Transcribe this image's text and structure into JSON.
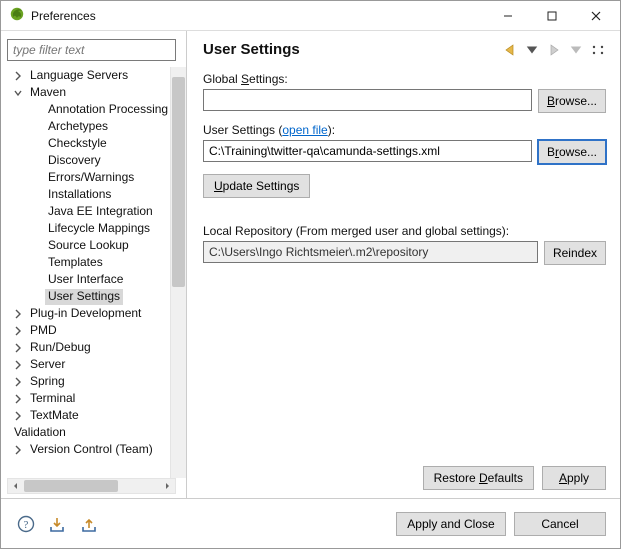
{
  "window": {
    "title": "Preferences"
  },
  "filter": {
    "placeholder": "type filter text",
    "value": ""
  },
  "tree": [
    {
      "label": "Language Servers",
      "depth": 0,
      "expand": "closed"
    },
    {
      "label": "Maven",
      "depth": 0,
      "expand": "open"
    },
    {
      "label": "Annotation Processing",
      "depth": 1,
      "expand": "none"
    },
    {
      "label": "Archetypes",
      "depth": 1,
      "expand": "none"
    },
    {
      "label": "Checkstyle",
      "depth": 1,
      "expand": "none"
    },
    {
      "label": "Discovery",
      "depth": 1,
      "expand": "none"
    },
    {
      "label": "Errors/Warnings",
      "depth": 1,
      "expand": "none"
    },
    {
      "label": "Installations",
      "depth": 1,
      "expand": "none"
    },
    {
      "label": "Java EE Integration",
      "depth": 1,
      "expand": "none"
    },
    {
      "label": "Lifecycle Mappings",
      "depth": 1,
      "expand": "none"
    },
    {
      "label": "Source Lookup",
      "depth": 1,
      "expand": "none"
    },
    {
      "label": "Templates",
      "depth": 1,
      "expand": "none"
    },
    {
      "label": "User Interface",
      "depth": 1,
      "expand": "none"
    },
    {
      "label": "User Settings",
      "depth": 1,
      "expand": "none",
      "selected": true
    },
    {
      "label": "Plug-in Development",
      "depth": 0,
      "expand": "closed"
    },
    {
      "label": "PMD",
      "depth": 0,
      "expand": "closed"
    },
    {
      "label": "Run/Debug",
      "depth": 0,
      "expand": "closed"
    },
    {
      "label": "Server",
      "depth": 0,
      "expand": "closed"
    },
    {
      "label": "Spring",
      "depth": 0,
      "expand": "closed"
    },
    {
      "label": "Terminal",
      "depth": 0,
      "expand": "closed"
    },
    {
      "label": "TextMate",
      "depth": 0,
      "expand": "closed"
    },
    {
      "label": "Validation",
      "depth": 0,
      "expand": "none"
    },
    {
      "label": "Version Control (Team)",
      "depth": 0,
      "expand": "closed"
    }
  ],
  "pane": {
    "title": "User Settings",
    "global": {
      "label_pre": "Global ",
      "label_u": "S",
      "label_post": "ettings:",
      "value": "",
      "browse_pre": "",
      "browse_u": "B",
      "browse_post": "rowse..."
    },
    "user": {
      "label": "User Settings (",
      "link": "open file",
      "label_end": "):",
      "value": "C:\\Training\\twitter-qa\\camunda-settings.xml",
      "browse_pre": "B",
      "browse_u": "r",
      "browse_post": "owse..."
    },
    "update_pre": "",
    "update_u": "U",
    "update_post": "pdate Settings",
    "localrepo": {
      "label": "Local Repository (From merged user and global settings):",
      "value": "C:\\Users\\Ingo Richtsmeier\\.m2\\repository",
      "reindex": "Reindex"
    },
    "restore_pre": "Restore ",
    "restore_u": "D",
    "restore_post": "efaults",
    "apply_u": "A",
    "apply_post": "pply"
  },
  "bottom": {
    "apply_close": "Apply and Close",
    "cancel": "Cancel"
  }
}
